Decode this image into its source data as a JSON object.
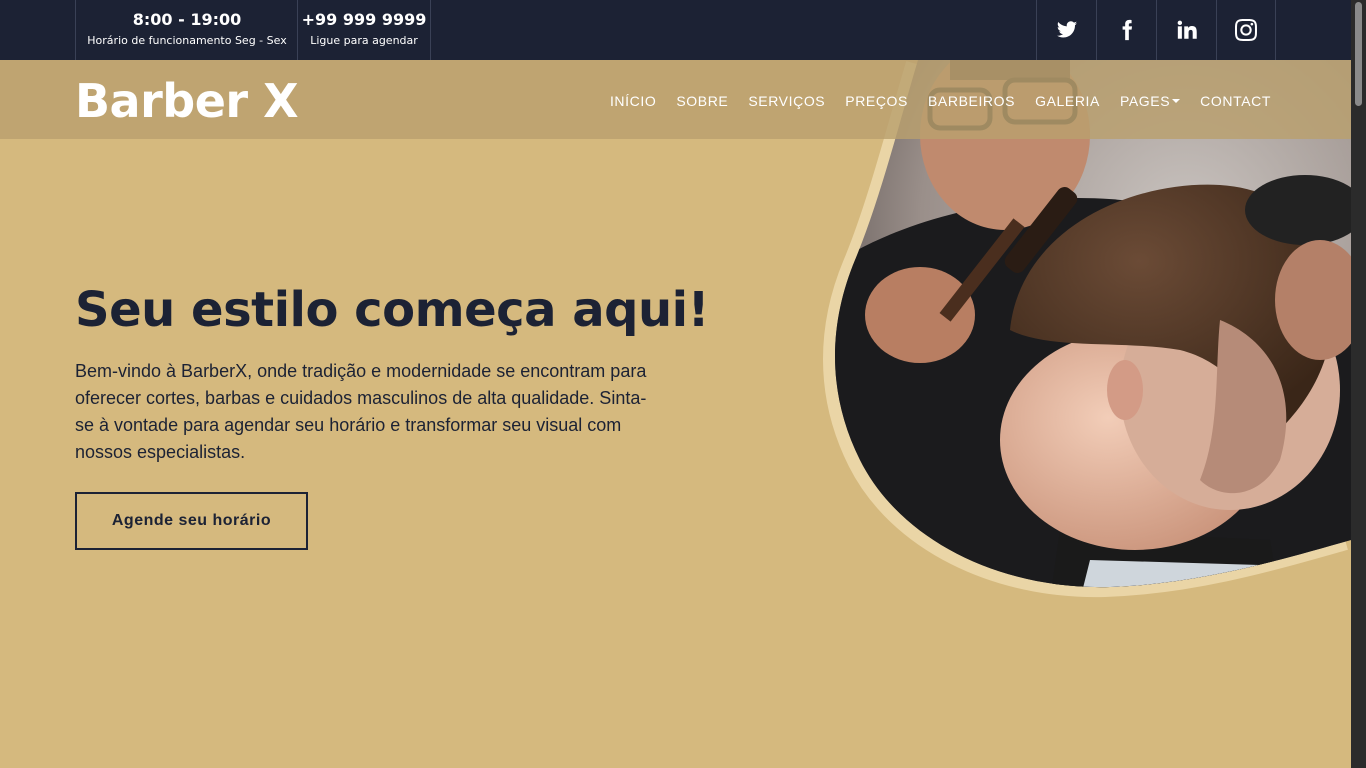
{
  "topbar": {
    "hours": {
      "main": "8:00 - 19:00",
      "sub": "Horário de funcionamento Seg - Sex"
    },
    "phone": {
      "main": "+99 999 9999",
      "sub": "Ligue para agendar"
    },
    "socials": [
      {
        "icon": "twitter-icon"
      },
      {
        "icon": "facebook-icon"
      },
      {
        "icon": "linkedin-icon"
      },
      {
        "icon": "instagram-icon"
      }
    ]
  },
  "nav": {
    "brand": "Barber ",
    "brand_mark": "X",
    "links": [
      "INÍCIO",
      "SOBRE",
      "SERVIÇOS",
      "PREÇOS",
      "BARBEIROS",
      "GALERIA",
      "PAGES",
      "CONTACT"
    ]
  },
  "hero": {
    "title": "Seu estilo começa aqui!",
    "description": "Bem-vindo à BarberX, onde tradição e modernidade se encontram para oferecer cortes, barbas e cuidados masculinos de alta qualidade. Sinta-se à vontade para agendar seu horário e transformar seu visual com nossos especialistas.",
    "cta": "Agende seu horário"
  },
  "colors": {
    "primary_dark": "#1c2234",
    "accent_gold": "#d5b97e",
    "text_white": "#ffffff"
  }
}
